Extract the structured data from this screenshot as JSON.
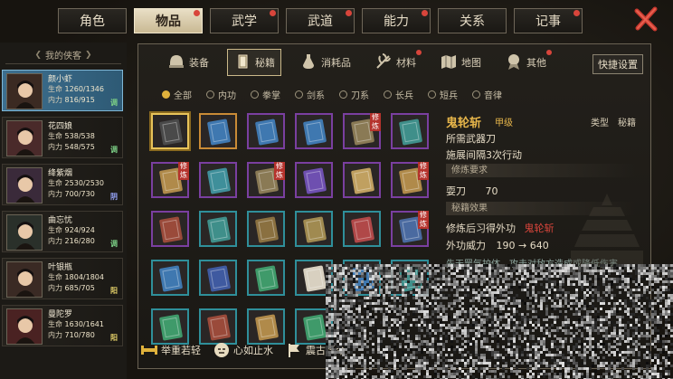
{
  "top_tabs": [
    {
      "label": "角色",
      "active": false,
      "dot": false
    },
    {
      "label": "物品",
      "active": true,
      "dot": true
    },
    {
      "label": "武学",
      "active": false,
      "dot": true
    },
    {
      "label": "武道",
      "active": false,
      "dot": true
    },
    {
      "label": "能力",
      "active": false,
      "dot": true
    },
    {
      "label": "关系",
      "active": false,
      "dot": false
    },
    {
      "label": "记事",
      "active": false,
      "dot": true
    }
  ],
  "roster": {
    "title": "我的侠客",
    "heroes": [
      {
        "name": "颜小虾",
        "hp_label": "生命",
        "hp": "1260/1346",
        "mp_label": "内力",
        "mp": "816/915",
        "align": "调",
        "active": true
      },
      {
        "name": "花四娘",
        "hp_label": "生命",
        "hp": "538/538",
        "mp_label": "内力",
        "mp": "548/575",
        "align": "调",
        "active": false
      },
      {
        "name": "绛紫烟",
        "hp_label": "生命",
        "hp": "2530/2530",
        "mp_label": "内力",
        "mp": "700/730",
        "align": "阴",
        "active": false
      },
      {
        "name": "曲忘忧",
        "hp_label": "生命",
        "hp": "924/924",
        "mp_label": "内力",
        "mp": "216/280",
        "align": "调",
        "active": false
      },
      {
        "name": "叶银瓶",
        "hp_label": "生命",
        "hp": "1804/1804",
        "mp_label": "内力",
        "mp": "685/705",
        "align": "阳",
        "active": false
      },
      {
        "name": "曼陀罗",
        "hp_label": "生命",
        "hp": "1630/1641",
        "mp_label": "内力",
        "mp": "710/780",
        "align": "阳",
        "active": false
      }
    ]
  },
  "categories": [
    {
      "label": "装备",
      "icon": "helmet-icon",
      "active": false,
      "dot": false
    },
    {
      "label": "秘籍",
      "icon": "book-icon",
      "active": true,
      "dot": false
    },
    {
      "label": "消耗品",
      "icon": "potion-icon",
      "active": false,
      "dot": false
    },
    {
      "label": "材料",
      "icon": "herb-icon",
      "active": false,
      "dot": true
    },
    {
      "label": "地图",
      "icon": "map-icon",
      "active": false,
      "dot": false
    },
    {
      "label": "其他",
      "icon": "medal-icon",
      "active": false,
      "dot": true
    }
  ],
  "quick_settings": "快捷设置",
  "filters": [
    {
      "label": "全部",
      "active": true
    },
    {
      "label": "内功",
      "active": false
    },
    {
      "label": "拳掌",
      "active": false
    },
    {
      "label": "剑系",
      "active": false
    },
    {
      "label": "刀系",
      "active": false
    },
    {
      "label": "长兵",
      "active": false
    },
    {
      "label": "短兵",
      "active": false
    },
    {
      "label": "音律",
      "active": false
    }
  ],
  "tag_text": "修炼",
  "slots": [
    {
      "frame": "orange",
      "book": "#4a4a4a",
      "tag": false,
      "sel": true
    },
    {
      "frame": "orange",
      "book": "#3f78b0",
      "tag": false,
      "sel": false
    },
    {
      "frame": "purple",
      "book": "#3f78b0",
      "tag": false,
      "sel": false
    },
    {
      "frame": "purple",
      "book": "#3f78b0",
      "tag": false,
      "sel": false
    },
    {
      "frame": "purple",
      "book": "#8a7a55",
      "tag": true,
      "sel": false
    },
    {
      "frame": "purple",
      "book": "#3f8f8a",
      "tag": false,
      "sel": false
    },
    {
      "frame": "purple",
      "book": "#b08a4a",
      "tag": true,
      "sel": false
    },
    {
      "frame": "purple",
      "book": "#3f8f9a",
      "tag": false,
      "sel": false
    },
    {
      "frame": "purple",
      "book": "#8a7a55",
      "tag": true,
      "sel": false
    },
    {
      "frame": "purple",
      "book": "#6e4fb0",
      "tag": false,
      "sel": false
    },
    {
      "frame": "purple",
      "book": "#c0a060",
      "tag": false,
      "sel": false
    },
    {
      "frame": "purple",
      "book": "#b08a4a",
      "tag": true,
      "sel": false
    },
    {
      "frame": "purple",
      "book": "#9a4a3a",
      "tag": false,
      "sel": false
    },
    {
      "frame": "blue",
      "book": "#3f8f8a",
      "tag": false,
      "sel": false
    },
    {
      "frame": "blue",
      "book": "#8a7040",
      "tag": false,
      "sel": false
    },
    {
      "frame": "blue",
      "book": "#a08a50",
      "tag": false,
      "sel": false
    },
    {
      "frame": "blue",
      "book": "#b04848",
      "tag": false,
      "sel": false
    },
    {
      "frame": "purple",
      "book": "#4a6aa0",
      "tag": true,
      "sel": false
    },
    {
      "frame": "blue",
      "book": "#3f78b0",
      "tag": false,
      "sel": false
    },
    {
      "frame": "blue",
      "book": "#3f5aa0",
      "tag": false,
      "sel": false
    },
    {
      "frame": "blue",
      "book": "#3f9a6a",
      "tag": false,
      "sel": false
    },
    {
      "frame": "blue",
      "book": "#d8d0c0",
      "tag": false,
      "sel": false
    },
    {
      "frame": "blue",
      "book": "#3f78b0",
      "tag": false,
      "sel": false
    },
    {
      "frame": "blue",
      "book": "#3f8f8a",
      "tag": false,
      "sel": false
    },
    {
      "frame": "blue",
      "book": "#3f9a6a",
      "tag": false,
      "sel": false
    },
    {
      "frame": "blue",
      "book": "#9a4a3a",
      "tag": false,
      "sel": false
    },
    {
      "frame": "blue",
      "book": "#b08a4a",
      "tag": false,
      "sel": false
    },
    {
      "frame": "blue",
      "book": "#3f9a6a",
      "tag": false,
      "sel": false
    }
  ],
  "detail": {
    "name": "鬼轮斩",
    "grade": "甲级",
    "type_label": "类型",
    "type_value": "秘籍",
    "weapon": "所需武器刀",
    "cast": "施展间隔3次行动",
    "req_title": "修炼要求",
    "req_item": "耍刀",
    "req_value": "70",
    "effect_title": "秘籍效果",
    "effect_line_prefix": "修炼后习得外功",
    "effect_line_skill": "鬼轮斩",
    "power_label": "外功威力",
    "power_value": "190 → 640",
    "desc_partial": "先天罡气护体，攻击对敌方造成或降低伤害。"
  },
  "bottom_skills": [
    {
      "label": "举重若轻",
      "icon": "weight-icon"
    },
    {
      "label": "心如止水",
      "icon": "calm-face-icon"
    },
    {
      "label": "震古烁今",
      "icon": "banner-icon"
    }
  ],
  "colors": {
    "accent_gold": "#e6b54a",
    "red_dot": "#d8453b",
    "active_tab": "#e9dfc6",
    "hero_active": "#3d6f8f",
    "frame_purple": "#7a3fa0",
    "frame_blue": "#2f8f9a",
    "frame_orange": "#c98b36"
  }
}
